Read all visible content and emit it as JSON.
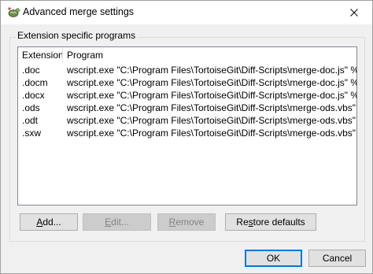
{
  "window": {
    "title": "Advanced merge settings",
    "close_label": "✕"
  },
  "group": {
    "label": "Extension specific programs"
  },
  "list": {
    "columns": [
      "Extension",
      "Program"
    ],
    "rows": [
      {
        "extension": ".doc",
        "program": "wscript.exe \"C:\\Program Files\\TortoiseGit\\Diff-Scripts\\merge-doc.js\" %merg..."
      },
      {
        "extension": ".docm",
        "program": "wscript.exe \"C:\\Program Files\\TortoiseGit\\Diff-Scripts\\merge-doc.js\" %merg..."
      },
      {
        "extension": ".docx",
        "program": "wscript.exe \"C:\\Program Files\\TortoiseGit\\Diff-Scripts\\merge-doc.js\" %merg..."
      },
      {
        "extension": ".ods",
        "program": "wscript.exe \"C:\\Program Files\\TortoiseGit\\Diff-Scripts\\merge-ods.vbs\" %me..."
      },
      {
        "extension": ".odt",
        "program": "wscript.exe \"C:\\Program Files\\TortoiseGit\\Diff-Scripts\\merge-ods.vbs\" %me..."
      },
      {
        "extension": ".sxw",
        "program": "wscript.exe \"C:\\Program Files\\TortoiseGit\\Diff-Scripts\\merge-ods.vbs\" %me..."
      }
    ]
  },
  "buttons": {
    "add": {
      "mnemonic": "A",
      "rest": "dd..."
    },
    "edit": {
      "mnemonic": "E",
      "rest": "dit..."
    },
    "remove": {
      "mnemonic": "R",
      "rest": "emove"
    },
    "restore": {
      "pre": "Re",
      "mnemonic": "s",
      "rest": "tore defaults"
    },
    "ok": "OK",
    "cancel": "Cancel"
  }
}
